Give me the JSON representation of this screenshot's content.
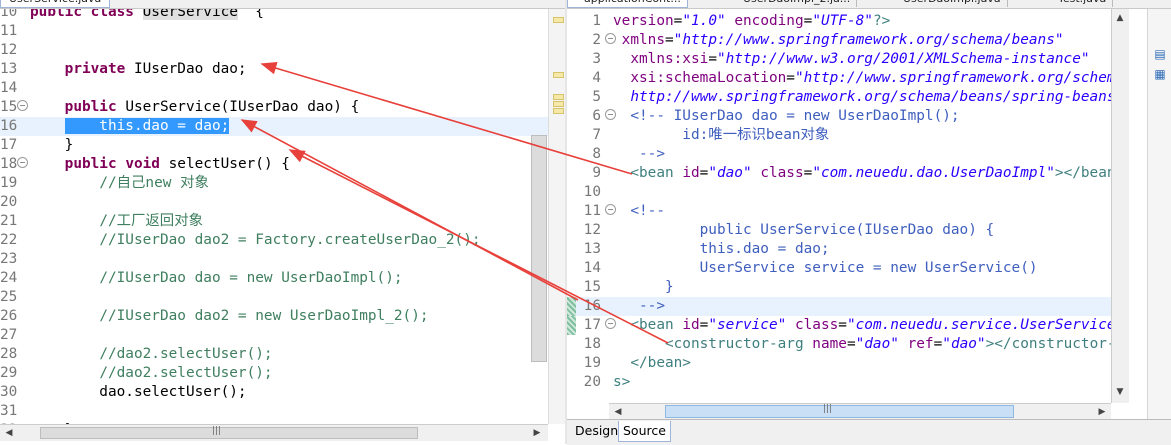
{
  "left_editor": {
    "tab_label": "UserService.java",
    "lines": [
      {
        "n": "10",
        "parts": [
          [
            "kw",
            "public "
          ],
          [
            "kw",
            "class "
          ],
          [
            "occur",
            "UserService"
          ],
          [
            "",
            "  {"
          ]
        ]
      },
      {
        "n": "11",
        "parts": []
      },
      {
        "n": "12",
        "parts": []
      },
      {
        "n": "13",
        "parts": [
          [
            "",
            "    "
          ],
          [
            "kw",
            "private "
          ],
          [
            "",
            "IUserDao dao;"
          ]
        ]
      },
      {
        "n": "14",
        "parts": []
      },
      {
        "n": "15",
        "fold": "-",
        "parts": [
          [
            "",
            "    "
          ],
          [
            "kw",
            "public "
          ],
          [
            "",
            "UserService(IUserDao dao) {"
          ]
        ]
      },
      {
        "n": "16",
        "current": true,
        "parts": [
          [
            "",
            "    "
          ],
          [
            "sel",
            "    this.dao = dao;"
          ]
        ]
      },
      {
        "n": "17",
        "parts": [
          [
            "",
            "    }"
          ]
        ]
      },
      {
        "n": "18",
        "fold": "-",
        "parts": [
          [
            "",
            "    "
          ],
          [
            "kw",
            "public "
          ],
          [
            "kw",
            "void "
          ],
          [
            "",
            "selectUser() {"
          ]
        ]
      },
      {
        "n": "19",
        "parts": [
          [
            "",
            "        "
          ],
          [
            "cm",
            "//自己new 对象"
          ]
        ]
      },
      {
        "n": "20",
        "parts": []
      },
      {
        "n": "21",
        "parts": [
          [
            "",
            "        "
          ],
          [
            "cm",
            "//工厂返回对象"
          ]
        ]
      },
      {
        "n": "22",
        "parts": [
          [
            "",
            "        "
          ],
          [
            "cm",
            "//IUserDao dao2 = Factory.createUserDao_2();"
          ]
        ]
      },
      {
        "n": "23",
        "parts": []
      },
      {
        "n": "24",
        "parts": [
          [
            "",
            "        "
          ],
          [
            "cm",
            "//IUserDao dao = new UserDaoImpl();"
          ]
        ]
      },
      {
        "n": "25",
        "parts": []
      },
      {
        "n": "26",
        "parts": [
          [
            "",
            "        "
          ],
          [
            "cm",
            "//IUserDao dao2 = new UserDaoImpl_2();"
          ]
        ]
      },
      {
        "n": "27",
        "parts": []
      },
      {
        "n": "28",
        "parts": [
          [
            "",
            "        "
          ],
          [
            "cm",
            "//dao2.selectUser();"
          ]
        ]
      },
      {
        "n": "29",
        "parts": [
          [
            "",
            "        "
          ],
          [
            "cm",
            "//dao2.selectUser();"
          ]
        ]
      },
      {
        "n": "30",
        "parts": [
          [
            "",
            "        dao.selectUser();"
          ]
        ]
      },
      {
        "n": "31",
        "parts": []
      },
      {
        "n": "32",
        "parts": [
          [
            "",
            "    }"
          ]
        ]
      }
    ]
  },
  "right_editor": {
    "tabs": [
      "applicationCont...",
      "UserDaoImpl_2.ja...",
      "UserDaoImpl.java",
      "Test.java"
    ],
    "active_tab_index": 0,
    "lines": [
      {
        "n": "1",
        "parts": [
          [
            "attr",
            "version"
          ],
          [
            "",
            "="
          ],
          [
            "str",
            "\"1.0\""
          ],
          [
            "",
            " "
          ],
          [
            "attr",
            "encoding"
          ],
          [
            "",
            "="
          ],
          [
            "str",
            "\"UTF-8\""
          ],
          [
            "tag",
            "?>"
          ]
        ]
      },
      {
        "n": "2",
        "fold": "-",
        "parts": [
          [
            "",
            " "
          ],
          [
            "attr",
            "xmlns"
          ],
          [
            "",
            "="
          ],
          [
            "str",
            "\"http://www.springframework.org/schema/beans\""
          ]
        ]
      },
      {
        "n": "3",
        "parts": [
          [
            "",
            "  "
          ],
          [
            "attr",
            "xmlns:xsi"
          ],
          [
            "",
            "="
          ],
          [
            "str",
            "\"http://www.w3.org/2001/XMLSchema-instance\""
          ]
        ]
      },
      {
        "n": "4",
        "parts": [
          [
            "",
            "  "
          ],
          [
            "attr",
            "xsi:schemaLocation"
          ],
          [
            "",
            "="
          ],
          [
            "str",
            "\"http://www.springframework.org/schema/beans"
          ]
        ]
      },
      {
        "n": "5",
        "parts": [
          [
            "",
            "  "
          ],
          [
            "str",
            "http://www.springframework.org/schema/beans/spring-beans.xsd\""
          ]
        ]
      },
      {
        "n": "6",
        "fold": "-",
        "parts": [
          [
            "",
            "  "
          ],
          [
            "xcm",
            "<!-- IUserDao dao = new UserDaoImpl();"
          ]
        ]
      },
      {
        "n": "7",
        "parts": [
          [
            "xcm",
            "        id:唯一标识bean对象"
          ]
        ]
      },
      {
        "n": "8",
        "parts": [
          [
            "xcm",
            "   -->"
          ]
        ]
      },
      {
        "n": "9",
        "parts": [
          [
            "",
            "  "
          ],
          [
            "tag",
            "<bean "
          ],
          [
            "attr",
            "id"
          ],
          [
            "",
            "="
          ],
          [
            "str",
            "\"dao\""
          ],
          [
            "",
            " "
          ],
          [
            "attr",
            "class"
          ],
          [
            "",
            "="
          ],
          [
            "str",
            "\"com.neuedu.dao.UserDaoImpl\""
          ],
          [
            "tag",
            "></bean>"
          ]
        ]
      },
      {
        "n": "10",
        "parts": []
      },
      {
        "n": "11",
        "fold": "-",
        "parts": [
          [
            "",
            "  "
          ],
          [
            "xcm",
            "<!--"
          ]
        ]
      },
      {
        "n": "12",
        "parts": [
          [
            "xcm",
            "          public UserService(IUserDao dao) {"
          ]
        ]
      },
      {
        "n": "13",
        "parts": [
          [
            "xcm",
            "          this.dao = dao;"
          ]
        ]
      },
      {
        "n": "14",
        "parts": [
          [
            "xcm",
            "          UserService service = new UserService()"
          ]
        ]
      },
      {
        "n": "15",
        "parts": [
          [
            "xcm",
            "      }"
          ]
        ]
      },
      {
        "n": "16",
        "current": true,
        "changed": true,
        "parts": [
          [
            "xcm",
            "   -->"
          ]
        ]
      },
      {
        "n": "17",
        "fold": "-",
        "changed": true,
        "parts": [
          [
            "",
            "  "
          ],
          [
            "tag",
            "<bean "
          ],
          [
            "attr",
            "id"
          ],
          [
            "",
            "="
          ],
          [
            "str",
            "\"service\""
          ],
          [
            "",
            " "
          ],
          [
            "attr",
            "class"
          ],
          [
            "",
            "="
          ],
          [
            "str",
            "\"com.neuedu.service.UserService\""
          ],
          [
            "tag",
            ">"
          ]
        ]
      },
      {
        "n": "18",
        "parts": [
          [
            "",
            "      "
          ],
          [
            "tag",
            "<constructor-arg "
          ],
          [
            "attr",
            "name"
          ],
          [
            "",
            "="
          ],
          [
            "str",
            "\"dao\""
          ],
          [
            "",
            " "
          ],
          [
            "attr",
            "ref"
          ],
          [
            "",
            "="
          ],
          [
            "str",
            "\"dao\""
          ],
          [
            "tag",
            "></constructor-arg>"
          ]
        ]
      },
      {
        "n": "19",
        "parts": [
          [
            "",
            "  "
          ],
          [
            "tag",
            "</bean>"
          ]
        ]
      },
      {
        "n": "20",
        "parts": [
          [
            "tag",
            "s>"
          ]
        ]
      }
    ],
    "bottom_tabs": [
      "Design",
      "Source"
    ],
    "active_bottom_tab": 1
  },
  "colors": {
    "keyword": "#7f0055",
    "comment": "#3f7f5f",
    "xml_comment": "#3f5fbf",
    "xml_tag": "#3f7f7f",
    "xml_attr": "#7f007f",
    "xml_string": "#2a00ff",
    "selection": "#3399ff",
    "current_line": "#e8f2fe",
    "annotation_arrow": "#e8403a"
  },
  "icons": {
    "fold_marker": "minus-circle-icon",
    "scroll_left": "◀",
    "scroll_right": "▶",
    "scroll_up": "▲",
    "scroll_down": "▼",
    "grip": "|||"
  }
}
